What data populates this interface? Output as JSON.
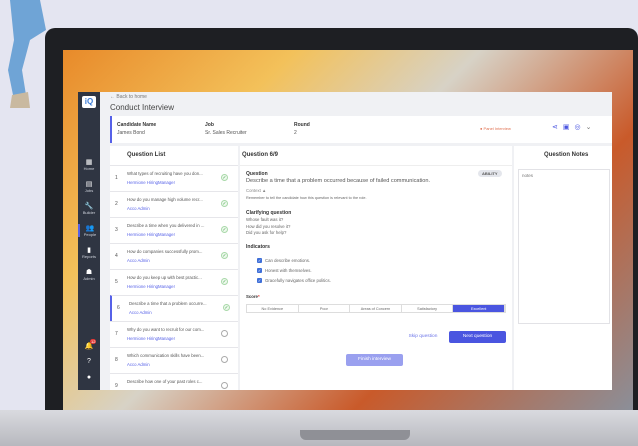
{
  "app": {
    "logo": "iQ",
    "back": "Back to home",
    "title": "Conduct Interview"
  },
  "sidebar": {
    "items": [
      {
        "label": "Home",
        "icon": "▦"
      },
      {
        "label": "Jobs",
        "icon": "▤"
      },
      {
        "label": "Builder",
        "icon": "🔧"
      },
      {
        "label": "People",
        "icon": "👥"
      },
      {
        "label": "Reports",
        "icon": "▮"
      },
      {
        "label": "Admin",
        "icon": "☗"
      }
    ],
    "badge": "12"
  },
  "header": {
    "candidate_label": "Candidate Name",
    "candidate": "James Bond",
    "job_label": "Job",
    "job": "Sr. Sales Recruiter",
    "round_label": "Round",
    "round": "2",
    "status": "Panel Interview"
  },
  "list": {
    "title": "Question List",
    "items": [
      {
        "n": "1",
        "q": "What types of recruiting have you don...",
        "who": "Hermione HiringManager",
        "done": true
      },
      {
        "n": "2",
        "q": "How do you manage high volume recr...",
        "who": "Acco Admin",
        "done": true
      },
      {
        "n": "3",
        "q": "Describe a time when you delivered in ...",
        "who": "Hermione HiringManager",
        "done": true
      },
      {
        "n": "4",
        "q": "How do companies successfully prom...",
        "who": "Acco Admin",
        "done": true
      },
      {
        "n": "5",
        "q": "How do you keep up with best practic...",
        "who": "Hermione HiringManager",
        "done": true
      },
      {
        "n": "6",
        "q": "Describe a time that a problem occurre...",
        "who": "Acco Admin",
        "done": true
      },
      {
        "n": "7",
        "q": "Why do you want to recruit for our com...",
        "who": "Hermione HiringManager",
        "done": false
      },
      {
        "n": "8",
        "q": "Which communication skills have been...",
        "who": "Acco Admin",
        "done": false
      },
      {
        "n": "9",
        "q": "Describe how one of your past roles c...",
        "who": "",
        "done": false
      }
    ]
  },
  "question": {
    "header": "Question 6/9",
    "label": "Question",
    "tag": "ABILITY",
    "text": "Describe a time that a problem occurred because of failed communication.",
    "context_label": "Context",
    "context": "Remember to tell the candidate how this question is relevant to the role.",
    "clarifying_label": "Clarifying question",
    "clarifying": [
      "Whose fault was it?",
      "How did you resolve it?",
      "Did you ask for help?"
    ],
    "indicators_label": "Indicators",
    "indicators": [
      "Can describe emotions.",
      "Honest with themselves.",
      "Gracefully navigates office politics."
    ],
    "score_label": "Score",
    "scores": [
      "No Evidence",
      "Poor",
      "Areas of Concern",
      "Satisfactory",
      "Excellent"
    ],
    "selected_score": "Excellent",
    "skip": "Skip question",
    "next": "Next question",
    "finish": "Finish interview"
  },
  "notes": {
    "title": "Question Notes",
    "value": "notes"
  },
  "colors": {
    "accent": "#4a55e0",
    "sidebar": "#2f3542"
  }
}
